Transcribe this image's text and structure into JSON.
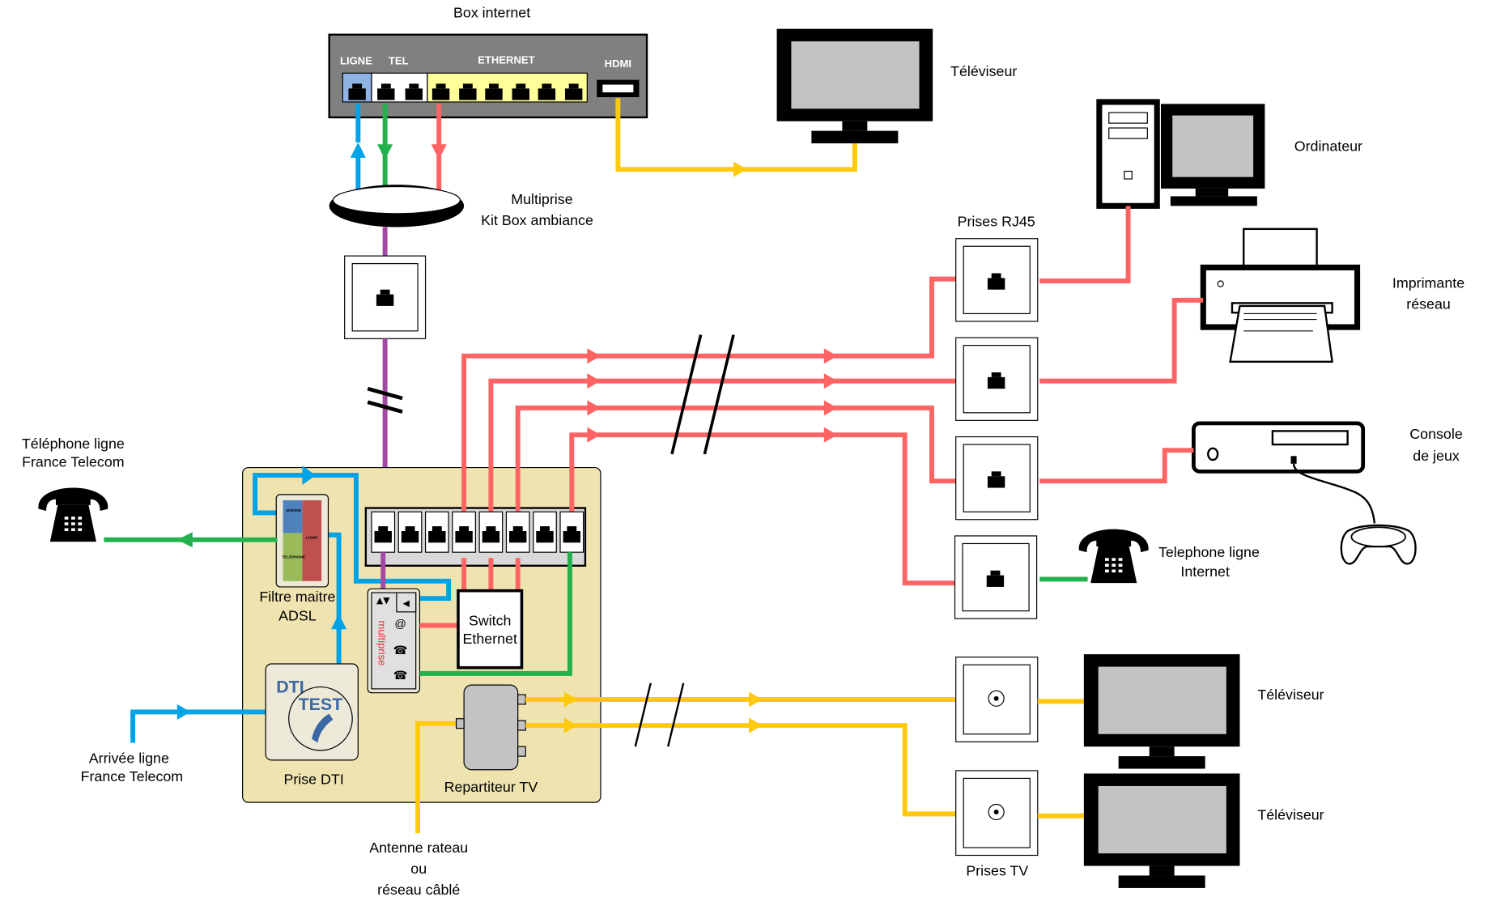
{
  "diagram": {
    "title": "Box internet",
    "colors": {
      "adsl_line": "#00a2e8",
      "phone": "#22b14c",
      "ethernet": "#ff6464",
      "box_link": "#a349a4",
      "tv_coax": "#ffc90e",
      "panel_bg": "#efe4b0",
      "box_body": "#808080"
    },
    "box": {
      "label": "Box internet",
      "port_labels": {
        "ligne": "LIGNE",
        "tel": "TEL",
        "ethernet": "ETHERNET",
        "hdmi": "HDMI"
      }
    },
    "multiprise_kit": {
      "line1": "Multiprise",
      "line2": "Kit Box ambiance"
    },
    "panel": {
      "filter": {
        "line1": "Filtre maitre",
        "line2": "ADSL",
        "tags": [
          "MODEM",
          "TELEPHONE",
          "LIGNE"
        ]
      },
      "dti": {
        "label": "Prise DTI",
        "title": "DTI",
        "test": "TEST"
      },
      "multiprise": {
        "label": "multiprise",
        "at_symbol": "@"
      },
      "switch": {
        "line1": "Switch",
        "line2": "Ethernet"
      },
      "splitter": {
        "label": "Repartiteur TV"
      }
    },
    "labels": {
      "tel_ft_line1": "Téléphone ligne",
      "tel_ft_line2": "France Telecom",
      "arrivee_line1": "Arrivée ligne",
      "arrivee_line2": "France Telecom",
      "antenne_line1": "Antenne rateau",
      "antenne_line2": "ou",
      "antenne_line3": "réseau câblé",
      "prises_rj45": "Prises RJ45",
      "prises_tv": "Prises  TV"
    },
    "devices": {
      "tv_top": "Téléviseur",
      "ordinateur": "Ordinateur",
      "imprimante_line1": "Imprimante",
      "imprimante_line2": "réseau",
      "console_line1": "Console",
      "console_line2": "de jeux",
      "tel_internet_line1": "Telephone ligne",
      "tel_internet_line2": "Internet",
      "tv_1": "Téléviseur",
      "tv_2": "Téléviseur"
    }
  }
}
